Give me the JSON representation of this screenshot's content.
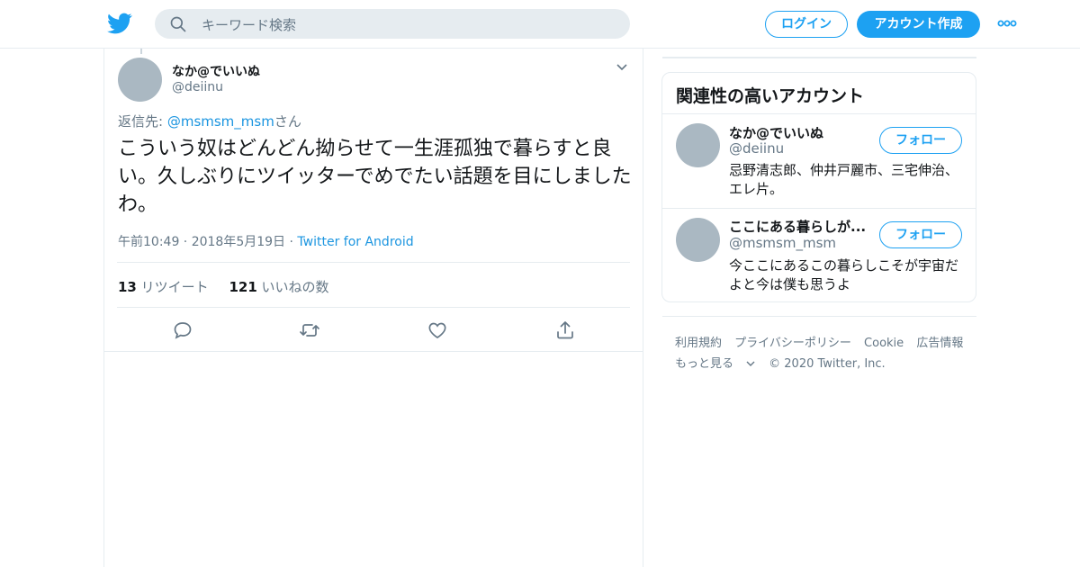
{
  "header": {
    "search_placeholder": "キーワード検索",
    "login_label": "ログイン",
    "signup_label": "アカウント作成",
    "brand_color": "#1da1f2"
  },
  "tweet": {
    "name": "なか@でいいぬ",
    "handle": "@deiinu",
    "reply_prefix": "返信先: ",
    "reply_to": "@msmsm_msm",
    "reply_suffix": "さん",
    "text": "こういう奴はどんどん拗らせて一生涯孤独で暮らすと良い。久しぶりにツイッターでめでたい話題を目にしましたわ。",
    "time": "午前10:49 · 2018年5月19日",
    "source_sep": " · ",
    "source": "Twitter for Android",
    "retweets_count": "13",
    "retweets_label": "リツイート",
    "likes_count": "121",
    "likes_label": "いいねの数"
  },
  "related": {
    "title": "関連性の高いアカウント",
    "follow_label": "フォロー",
    "accounts": [
      {
        "name": "なか@でいいぬ",
        "handle": "@deiinu",
        "bio": "忌野清志郎、仲井戸麗市、三宅伸治、エレ片。"
      },
      {
        "name": "ここにある暮らしが...",
        "handle": "@msmsm_msm",
        "bio": "今ここにあるこの暮らしこそが宇宙だよと今は僕も思うよ"
      }
    ]
  },
  "footer": {
    "links": [
      "利用規約",
      "プライバシーポリシー",
      "Cookie",
      "広告情報"
    ],
    "more": "もっと見る",
    "copyright": "© 2020 Twitter, Inc."
  }
}
